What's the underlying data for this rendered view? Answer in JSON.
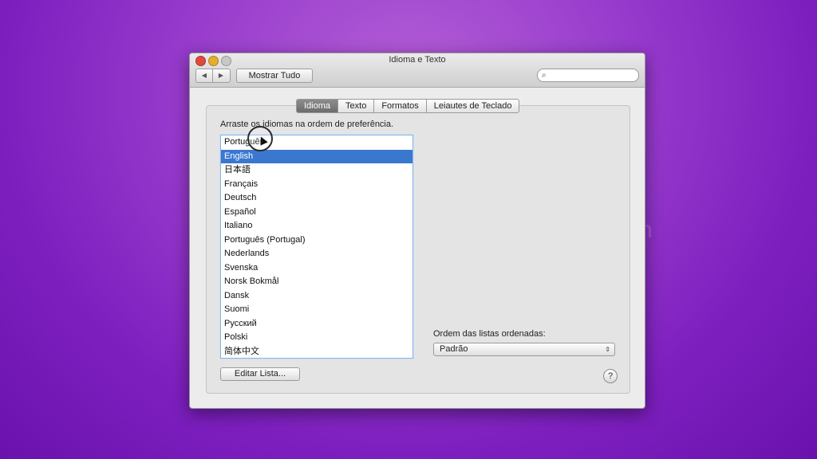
{
  "window": {
    "title": "Idioma e Texto"
  },
  "toolbar": {
    "show_all_label": "Mostrar Tudo",
    "back_icon": "◀",
    "forward_icon": "▶",
    "search_icon": "🔍",
    "search_value": ""
  },
  "tabs": [
    {
      "label": "Idioma"
    },
    {
      "label": "Texto"
    },
    {
      "label": "Formatos"
    },
    {
      "label": "Leiautes de Teclado"
    }
  ],
  "selected_tab": "Idioma",
  "language": {
    "instruction": "Arraste os idiomas na ordem de preferência.",
    "items": [
      {
        "label": "Português"
      },
      {
        "label": "English"
      },
      {
        "label": "日本語"
      },
      {
        "label": "Français"
      },
      {
        "label": "Deutsch"
      },
      {
        "label": "Español"
      },
      {
        "label": "Italiano"
      },
      {
        "label": "Português (Portugal)"
      },
      {
        "label": "Nederlands"
      },
      {
        "label": "Svenska"
      },
      {
        "label": "Norsk Bokmål"
      },
      {
        "label": "Dansk"
      },
      {
        "label": "Suomi"
      },
      {
        "label": "Русский"
      },
      {
        "label": "Polski"
      },
      {
        "label": "简体中文"
      }
    ],
    "selected_item": "English",
    "edit_list_label": "Editar Lista..."
  },
  "sort": {
    "label": "Ordem das listas ordenadas:",
    "value": "Padrão",
    "arrow_icon": "⇕"
  },
  "help_label": "?",
  "colors": {
    "selection": "#3a78d0",
    "background": "#8a2fc8"
  }
}
